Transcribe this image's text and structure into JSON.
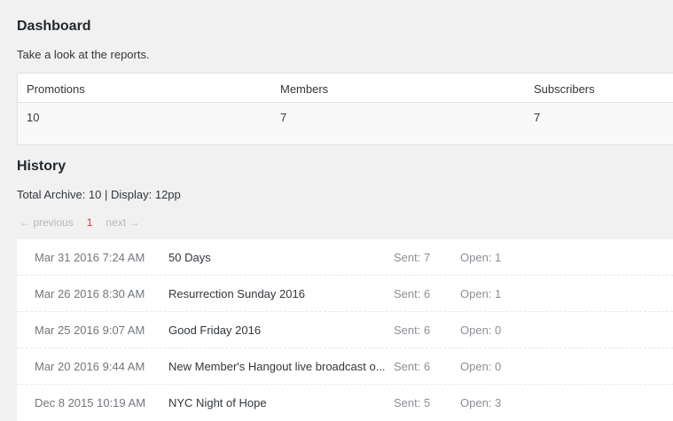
{
  "dashboard": {
    "title": "Dashboard",
    "description": "Take a look at the reports.",
    "stats": [
      {
        "label": "Promotions",
        "value": "10"
      },
      {
        "label": "Members",
        "value": "7"
      },
      {
        "label": "Subscribers",
        "value": "7"
      }
    ]
  },
  "history": {
    "title": "History",
    "total_text": "Total Archive: 10 | Display: 12pp",
    "pagination": {
      "previous": "← previous",
      "current": "1",
      "next": "next →"
    },
    "rows": [
      {
        "date": "Mar 31 2016 7:24 AM",
        "title": "50 Days",
        "sent": "Sent: 7",
        "open": "Open: 1"
      },
      {
        "date": "Mar 26 2016 8:30 AM",
        "title": "Resurrection Sunday 2016",
        "sent": "Sent: 6",
        "open": "Open: 1"
      },
      {
        "date": "Mar 25 2016 9:07 AM",
        "title": "Good Friday 2016",
        "sent": "Sent: 6",
        "open": "Open: 0"
      },
      {
        "date": "Mar 20 2016 9:44 AM",
        "title": "New Member's Hangout live broadcast o...",
        "sent": "Sent: 6",
        "open": "Open: 0"
      },
      {
        "date": "Dec 8 2015 10:19 AM",
        "title": "NYC Night of Hope",
        "sent": "Sent: 5",
        "open": "Open: 3"
      }
    ]
  }
}
